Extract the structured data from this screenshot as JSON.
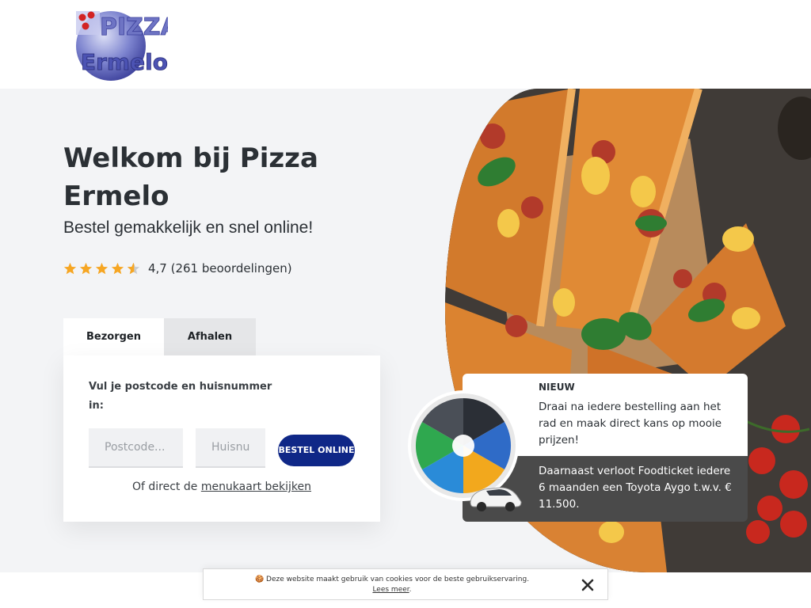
{
  "header": {
    "logo_text_line1": "PIZZA",
    "logo_text_line2": "Ermelo",
    "logo_icon": "pizza-ermelo-logo"
  },
  "hero": {
    "title": "Welkom bij Pizza Ermelo",
    "subtitle": "Bestel gemakkelijk en snel online!",
    "rating": {
      "stars": 4.7,
      "max_stars": 5,
      "text": "4,7 (261 beoordelingen)",
      "star_color": "#f6a623"
    }
  },
  "order": {
    "tabs": [
      {
        "label": "Bezorgen",
        "active": true
      },
      {
        "label": "Afhalen",
        "active": false
      }
    ],
    "prompt": "Vul je postcode en huisnummer in:",
    "postcode_placeholder": "Postcode...",
    "huisnummer_placeholder": "Huisnummer",
    "button_label": "BESTEL ONLINE",
    "menu_prefix": "Of direct de",
    "menu_link": "menukaart bekijken",
    "button_color": "#0f2787"
  },
  "promo": {
    "badge": "NIEUW",
    "description": "Draai na iedere bestelling aan het rad en maak direct kans op mooie prijzen!",
    "foodticket": "Daarnaast verloot Foodticket iedere 6 maanden een Toyota Aygo t.w.v. € 11.500.",
    "wheel_icon": "prize-wheel",
    "car_icon": "toyota-aygo-car"
  },
  "cookie": {
    "emoji": "🍪",
    "text": "Deze website maakt gebruik van cookies voor de beste gebruikservaring.",
    "link": "Lees meer",
    "link_suffix": ".",
    "close_icon": "close-icon"
  }
}
